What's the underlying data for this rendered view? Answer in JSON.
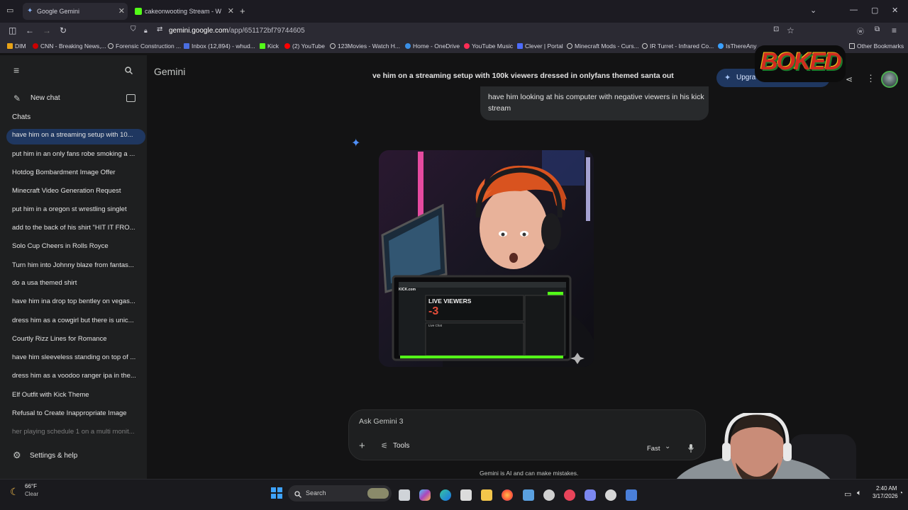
{
  "browser": {
    "tabs": [
      {
        "title": "Google Gemini",
        "active": true
      },
      {
        "title": "cakeonwooting Stream - W",
        "active": false
      }
    ],
    "url_prefix": "gemini.google.com",
    "url_path": "/app/651172bf79744605",
    "bookmarks": [
      "DIM",
      "CNN - Breaking News,...",
      "Forensic Construction ...",
      "Inbox (12,894) - whud...",
      "Kick",
      "(2) YouTube",
      "123Movies - Watch H...",
      "Home - OneDrive",
      "YouTube Music",
      "Clever | Portal",
      "Minecraft Mods - Curs...",
      "IR Turret - Infrared Co...",
      "IsThereAny"
    ],
    "other_bookmarks": "Other Bookmarks"
  },
  "sidebar": {
    "new_chat": "New chat",
    "chats_heading": "Chats",
    "chats": [
      "have him on a streaming setup with 10...",
      "put him in an only fans robe smoking a ...",
      "Hotdog Bombardment Image Offer",
      "Minecraft Video Generation Request",
      "put him in a oregon st wrestling singlet",
      "add to the back of his shirt \"HIT IT FRO...",
      "Solo Cup Cheers in Rolls Royce",
      "Turn him into Johnny blaze from fantas...",
      "do a usa themed shirt",
      "have him ina drop top bentley on vegas...",
      "dress him as a cowgirl but there is unic...",
      "Courtly Rizz Lines for Romance",
      "have him sleeveless standing on top of ...",
      "dress him as a voodoo ranger ipa in the...",
      "Elf Outfit with Kick Theme",
      "Refusal to Create Inappropriate Image",
      "her playing schedule 1 on a multi monit..."
    ],
    "settings": "Settings & help"
  },
  "header": {
    "brand": "Gemini",
    "conversation_title": "ve him on a streaming setup with 100k viewers dressed in onlyfans themed santa out",
    "upgrade_label": "Upgra",
    "overlay_logo": "BOKED"
  },
  "conversation": {
    "user_message": "have him looking at his computer with negative viewers in his kick stream",
    "image_monitor": {
      "label": "LIVE VIEWERS",
      "value": "-3",
      "site": "KICK.com",
      "chat_label": "Live Chat"
    }
  },
  "composer": {
    "placeholder": "Ask Gemini 3",
    "tools_label": "Tools",
    "mode_label": "Fast",
    "disclaimer": "Gemini is AI and can make mistakes."
  },
  "taskbar": {
    "weather_temp": "66°F",
    "weather_cond": "Clear",
    "search_label": "Search",
    "time": "2:40 AM",
    "date": "3/17/2026"
  },
  "colors": {
    "accent": "#0b57d0",
    "active_chat": "#1f3760",
    "negative": "#e54d3a"
  }
}
